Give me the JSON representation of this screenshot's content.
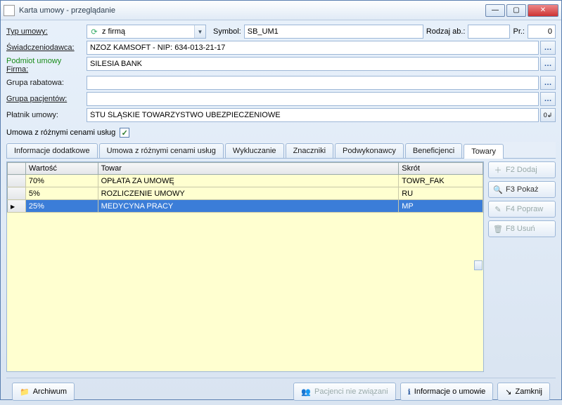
{
  "title": "Karta umowy - przeglądanie",
  "form": {
    "typ_umowy_lbl": "Typ umowy:",
    "typ_umowy_val": "z firmą",
    "symbol_lbl": "Symbol:",
    "symbol_val": "SB_UM1",
    "rodzaj_lbl": "Rodzaj ab.:",
    "rodzaj_val": "",
    "pr_lbl": "Pr.:",
    "pr_val": "0",
    "swiad_lbl": "Świadczeniodawca:",
    "swiad_val": "NZOZ KAMSOFT - NIP: 634-013-21-17",
    "podmiot_lbl": "Podmiot umowy",
    "firma_lbl": "Firma:",
    "firma_val": "SILESIA BANK",
    "grupa_rab_lbl": "Grupa rabatowa:",
    "grupa_rab_val": "",
    "grupa_pac_lbl": "Grupa pacjentów:",
    "grupa_pac_val": "",
    "platnik_lbl": "Płatnik umowy:",
    "platnik_val": "ŚTU ŚLĄSKIE TOWARZYSTWO UBEZPIECZENIOWE",
    "check_lbl": "Umowa z różnymi cenami usług"
  },
  "tabs": [
    "Informacje dodatkowe",
    "Umowa z różnymi cenami usług",
    "Wykluczanie",
    "Znaczniki",
    "Podwykonawcy",
    "Beneficjenci",
    "Towary"
  ],
  "grid": {
    "headers": {
      "wartosc": "Wartość",
      "towar": "Towar",
      "skrot": "Skrót"
    },
    "rows": [
      {
        "wartosc": "70%",
        "towar": "OPŁATA ZA UMOWĘ",
        "skrot": "TOWR_FAK",
        "selected": false
      },
      {
        "wartosc": "5%",
        "towar": "ROZLICZENIE UMOWY",
        "skrot": "RU",
        "selected": false
      },
      {
        "wartosc": "25%",
        "towar": "MEDYCYNA PRACY",
        "skrot": "MP",
        "selected": true
      }
    ]
  },
  "side": {
    "dodaj": "F2 Dodaj",
    "pokaz": "F3 Pokaż",
    "popraw": "F4 Popraw",
    "usun": "F8 Usuń"
  },
  "footer": {
    "archiwum": "Archiwum",
    "pacjenci": "Pacjenci nie związani",
    "info": "Informacje o umowie",
    "zamknij": "Zamknij"
  }
}
